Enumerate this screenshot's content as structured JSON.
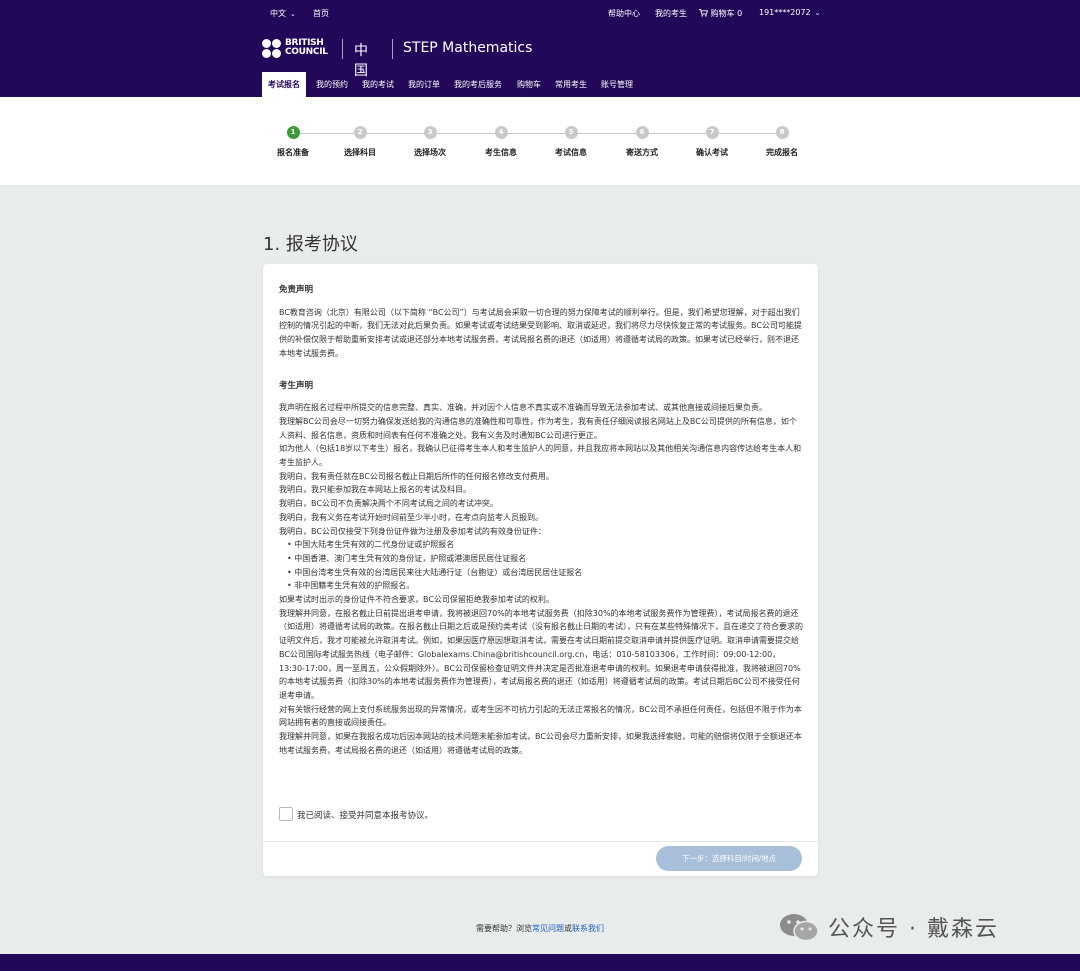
{
  "topbar": {
    "lang": "中文",
    "home": "首页",
    "help_center": "帮助中心",
    "my_candidates": "我的考生",
    "cart_label": "购物车 0",
    "cart_icon": "cart-icon",
    "user_phone": "191****2072"
  },
  "brand": {
    "logo_line1": "BRITISH",
    "logo_line2": "COUNCIL",
    "country": "中国",
    "product": "STEP Mathematics"
  },
  "nav": {
    "items": [
      "考试报名",
      "我的预约",
      "我的考试",
      "我的订单",
      "我的考后服务",
      "购物车",
      "常用考生",
      "账号管理"
    ],
    "active_index": 0
  },
  "stepper": {
    "current": 1,
    "steps": [
      {
        "num": "1",
        "label": "报名准备"
      },
      {
        "num": "2",
        "label": "选择科目"
      },
      {
        "num": "3",
        "label": "选择场次"
      },
      {
        "num": "4",
        "label": "考生信息"
      },
      {
        "num": "5",
        "label": "考试信息"
      },
      {
        "num": "6",
        "label": "寄送方式"
      },
      {
        "num": "7",
        "label": "确认考试"
      },
      {
        "num": "8",
        "label": "完成报名"
      }
    ]
  },
  "page_title": "1. 报考协议",
  "agreement": {
    "disclaimer_title": "免责声明",
    "disclaimer_text": "BC教育咨询（北京）有限公司（以下简称 “BC公司”）与考试局会采取一切合理的努力保障考试的顺利举行。但是，我们希望您理解，对于超出我们控制的情况引起的中断，我们无法对此后果负责。如果考试或考试结果受到影响、取消或延迟，我们将尽力尽快恢复正常的考试服务。BC公司可能提供的补偿仅限于帮助重新安排考试或退还部分本地考试服务费，考试局报名费的退还（如适用）将遵循考试局的政策。如果考试已经举行，则不退还本地考试服务费。",
    "declaration_title": "考生声明",
    "declaration_paragraphs": [
      "我声明在报名过程中所提交的信息完整、真实、准确，并对因个人信息不真实或不准确而导致无法参加考试、或其他直接或间接后果负责。",
      "我理解BC公司会尽一切努力确保发送给我的沟通信息的准确性和可靠性，作为考生，我有责任仔细阅读报名网站上及BC公司提供的所有信息，如个人资料、报名信息，资质和时间表有任何不准确之处，我有义务及时通知BC公司进行更正。",
      "如为他人（包括18岁以下考生）报名，我确认已征得考生本人和考生监护人的同意，并且我应将本网站以及其他相关沟通信息内容传达给考生本人和考生监护人。",
      "我明白，我有责任就在BC公司报名截止日期后所作的任何报名修改支付费用。",
      "我明白，我只能参加我在本网站上报名的考试及科目。",
      "我明白，BC公司不负责解决两个不同考试局之间的考试冲突。",
      "我明白，我有义务在考试开始时间前至少半小时，在考点向监考人员报到。",
      "我明白，BC公司仅接受下列身份证件做为注册及参加考试的有效身份证件："
    ],
    "id_bullets": [
      "中国大陆考生凭有效的二代身份证或护照报名",
      "中国香港、澳门考生凭有效的身份证，护照或港澳居民居住证报名",
      "中国台湾考生凭有效的台湾居民来往大陆通行证（台胞证）或台湾居民居住证报名",
      "非中国籍考生凭有效的护照报名。"
    ],
    "closing_paragraphs": [
      "如果考试时出示的身份证件不符合要求，BC公司保留拒绝我参加考试的权利。",
      "我理解并同意，在报名截止日前提出退考申请，我将被退回70%的本地考试服务费（扣除30%的本地考试服务费作为管理费），考试局报名费的退还（如适用）将遵循考试局的政策。在报名截止日期之后或是预约类考试（没有报名截止日期的考试），只有在某些特殊情况下，且在递交了符合要求的证明文件后，我才可能被允许取消考试。例如，如果因医疗原因想取消考试，需要在考试日期前提交取消申请并提供医疗证明。取消申请需要提交给BC公司国际考试服务热线（电子邮件：Globalexams.China@britishcouncil.org.cn，电话：010-58103306，工作时间：09:00-12:00，13:30-17:00，周一至周五，公众假期除外）。BC公司保留检查证明文件并决定是否批准退考申请的权利。如果退考申请获得批准，我将被退回70%的本地考试服务费（扣除30%的本地考试服务费作为管理费），考试局报名费的退还（如适用）将遵循考试局的政策。考试日期后BC公司不接受任何退考申请。",
      "对有关银行经营的网上支付系统服务出现的异常情况，或考生因不可抗力引起的无法正常报名的情况，BC公司不承担任何责任，包括但不限于作为本网站拥有者的直接或间接责任。",
      "我理解并同意，如果在我报名成功后因本网站的技术问题未能参加考试，BC公司会尽力重新安排，如果我选择索赔，可能的赔偿将仅限于全额退还本地考试服务费，考试局报名费的退还（如适用）将遵循考试局的政策。"
    ],
    "agree_label": "我已阅读、接受并同意本报考协议。",
    "agree_checked": false
  },
  "next_button": "下一步：选择科目/时间/地点",
  "help": {
    "prefix": "需要帮助？浏览",
    "faq": "常见问题",
    "or": "或",
    "contact": "联系我们"
  },
  "watermark": {
    "icon": "wechat-icon",
    "text": "公众号 · 戴森云"
  },
  "colors": {
    "header_bg": "#23085a",
    "step_active": "#3d9b35",
    "step_inactive": "#c9c9c9",
    "button_disabled": "#a7bfd9",
    "link": "#1f5fbf",
    "page_bg": "#e9ecec"
  }
}
